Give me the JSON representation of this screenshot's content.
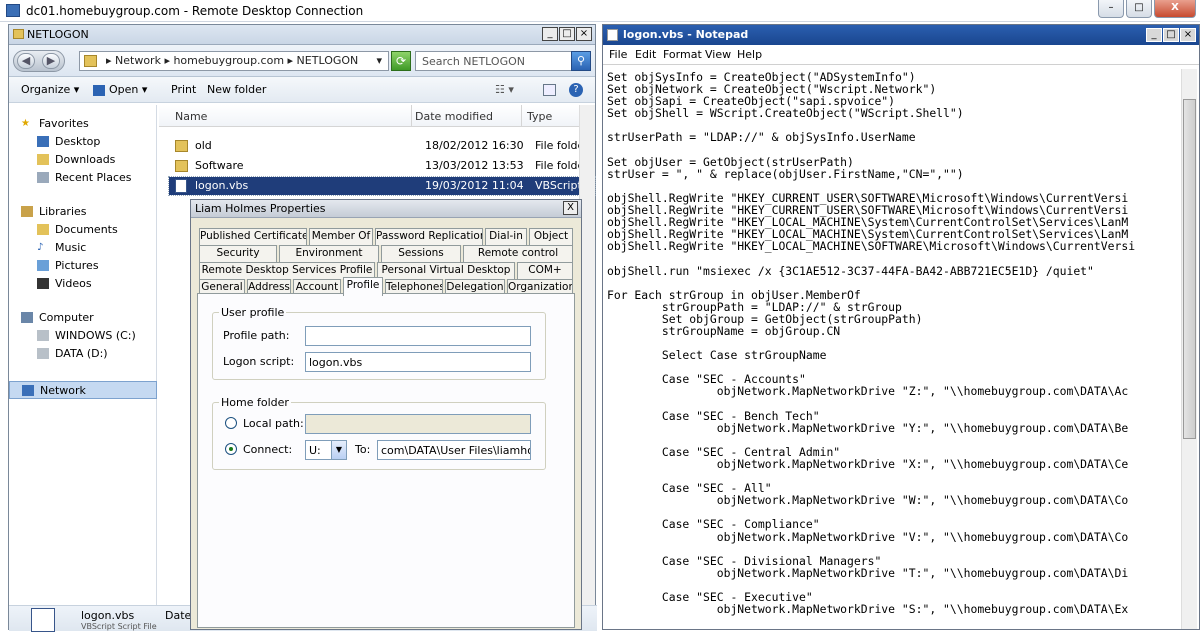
{
  "rdc": {
    "title": "dc01.homebuygroup.com - Remote Desktop Connection",
    "min": "–",
    "restore": "□",
    "close": "X"
  },
  "explorer": {
    "title": "NETLOGON",
    "crumb": "▸ Network ▸ homebuygroup.com ▸ NETLOGON",
    "search_placeholder": "Search NETLOGON",
    "toolbar": {
      "organize": "Organize ▾",
      "open": "Open ▾",
      "print": "Print",
      "new_folder": "New folder"
    },
    "nav": {
      "favorites": "Favorites",
      "desktop": "Desktop",
      "downloads": "Downloads",
      "recent": "Recent Places",
      "libraries": "Libraries",
      "documents": "Documents",
      "music": "Music",
      "pictures": "Pictures",
      "videos": "Videos",
      "computer": "Computer",
      "windows": "WINDOWS (C:)",
      "data": "DATA (D:)",
      "network": "Network"
    },
    "columns": {
      "name": "Name",
      "date": "Date modified",
      "type": "Type"
    },
    "files": [
      {
        "name": "old",
        "date": "18/02/2012 16:30",
        "type": "File folder"
      },
      {
        "name": "Software",
        "date": "13/03/2012 13:53",
        "type": "File folder"
      },
      {
        "name": "logon.vbs",
        "date": "19/03/2012 11:04",
        "type": "VBScript Script File"
      }
    ],
    "details": {
      "name": "logon.vbs",
      "date": "Date",
      "type": "VBScript Script File"
    }
  },
  "dialog": {
    "title": "Liam Holmes Properties",
    "close": "X",
    "tabs_row1": [
      "Published Certificates",
      "Member Of",
      "Password Replication",
      "Dial-in",
      "Object"
    ],
    "tabs_row2": [
      "Security",
      "Environment",
      "Sessions",
      "Remote control"
    ],
    "tabs_row3": [
      "Remote Desktop Services Profile",
      "Personal Virtual Desktop",
      "COM+"
    ],
    "tabs_row4": [
      "General",
      "Address",
      "Account",
      "Profile",
      "Telephones",
      "Delegation",
      "Organization"
    ],
    "user_profile": "User profile",
    "profile_path": "Profile path:",
    "profile_path_value": "",
    "logon_script": "Logon script:",
    "logon_script_value": "logon.vbs",
    "home_folder": "Home folder",
    "local_path": "Local path:",
    "connect": "Connect:",
    "drive": "U:",
    "to": "To:",
    "to_value": "com\\DATA\\User Files\\liamholmes"
  },
  "notepad": {
    "title": "logon.vbs - Notepad",
    "menu": [
      "File",
      "Edit",
      "Format",
      "View",
      "Help"
    ],
    "code": "Set objSysInfo = CreateObject(\"ADSystemInfo\")\nSet objNetwork = CreateObject(\"Wscript.Network\")\nSet objSapi = CreateObject(\"sapi.spvoice\")\nSet objShell = WScript.CreateObject(\"WScript.Shell\")\n\nstrUserPath = \"LDAP://\" & objSysInfo.UserName\n\nSet objUser = GetObject(strUserPath)\nstrUser = \", \" & replace(objUser.FirstName,\"CN=\",\"\")\n\nobjShell.RegWrite \"HKEY_CURRENT_USER\\SOFTWARE\\Microsoft\\Windows\\CurrentVersi\nobjShell.RegWrite \"HKEY_CURRENT_USER\\SOFTWARE\\Microsoft\\Windows\\CurrentVersi\nobjShell.RegWrite \"HKEY_LOCAL_MACHINE\\System\\CurrentControlSet\\Services\\LanM\nobjShell.RegWrite \"HKEY_LOCAL_MACHINE\\System\\CurrentControlSet\\Services\\LanM\nobjShell.RegWrite \"HKEY_LOCAL_MACHINE\\SOFTWARE\\Microsoft\\Windows\\CurrentVersi\n\nobjShell.run \"msiexec /x {3C1AE512-3C37-44FA-BA42-ABB721EC5E1D} /quiet\"\n\nFor Each strGroup in objUser.MemberOf\n        strGroupPath = \"LDAP://\" & strGroup\n        Set objGroup = GetObject(strGroupPath)\n        strGroupName = objGroup.CN\n\n        Select Case strGroupName\n\n        Case \"SEC - Accounts\"\n                objNetwork.MapNetworkDrive \"Z:\", \"\\\\homebuygroup.com\\DATA\\Ac\n\n        Case \"SEC - Bench Tech\"\n                objNetwork.MapNetworkDrive \"Y:\", \"\\\\homebuygroup.com\\DATA\\Be\n\n        Case \"SEC - Central Admin\"\n                objNetwork.MapNetworkDrive \"X:\", \"\\\\homebuygroup.com\\DATA\\Ce\n\n        Case \"SEC - All\"\n                objNetwork.MapNetworkDrive \"W:\", \"\\\\homebuygroup.com\\DATA\\Co\n\n        Case \"SEC - Compliance\"\n                objNetwork.MapNetworkDrive \"V:\", \"\\\\homebuygroup.com\\DATA\\Co\n\n        Case \"SEC - Divisional Managers\"\n                objNetwork.MapNetworkDrive \"T:\", \"\\\\homebuygroup.com\\DATA\\Di\n\n        Case \"SEC - Executive\"\n                objNetwork.MapNetworkDrive \"S:\", \"\\\\homebuygroup.com\\DATA\\Ex"
  }
}
